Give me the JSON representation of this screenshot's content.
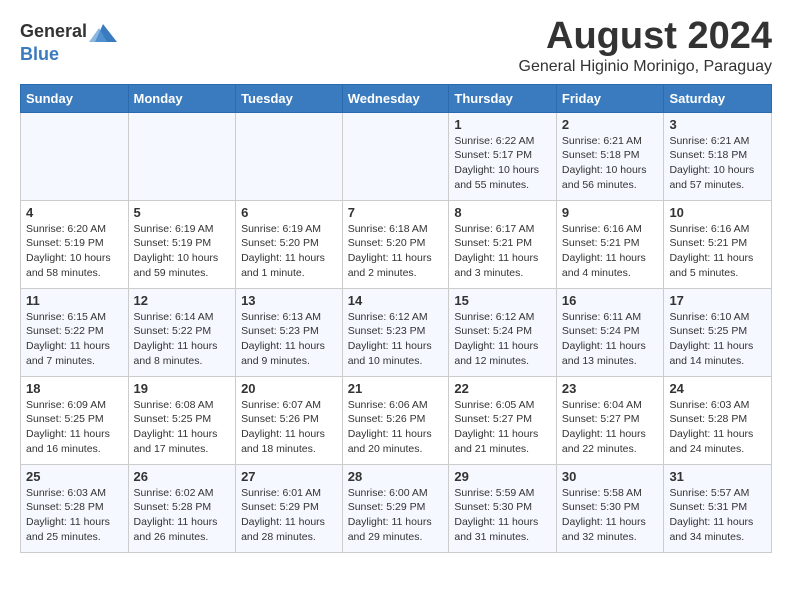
{
  "header": {
    "logo_general": "General",
    "logo_blue": "Blue",
    "title": "August 2024",
    "subtitle": "General Higinio Morinigo, Paraguay"
  },
  "days_of_week": [
    "Sunday",
    "Monday",
    "Tuesday",
    "Wednesday",
    "Thursday",
    "Friday",
    "Saturday"
  ],
  "weeks": [
    [
      {
        "day": "",
        "info": ""
      },
      {
        "day": "",
        "info": ""
      },
      {
        "day": "",
        "info": ""
      },
      {
        "day": "",
        "info": ""
      },
      {
        "day": "1",
        "info": "Sunrise: 6:22 AM\nSunset: 5:17 PM\nDaylight: 10 hours\nand 55 minutes."
      },
      {
        "day": "2",
        "info": "Sunrise: 6:21 AM\nSunset: 5:18 PM\nDaylight: 10 hours\nand 56 minutes."
      },
      {
        "day": "3",
        "info": "Sunrise: 6:21 AM\nSunset: 5:18 PM\nDaylight: 10 hours\nand 57 minutes."
      }
    ],
    [
      {
        "day": "4",
        "info": "Sunrise: 6:20 AM\nSunset: 5:19 PM\nDaylight: 10 hours\nand 58 minutes."
      },
      {
        "day": "5",
        "info": "Sunrise: 6:19 AM\nSunset: 5:19 PM\nDaylight: 10 hours\nand 59 minutes."
      },
      {
        "day": "6",
        "info": "Sunrise: 6:19 AM\nSunset: 5:20 PM\nDaylight: 11 hours\nand 1 minute."
      },
      {
        "day": "7",
        "info": "Sunrise: 6:18 AM\nSunset: 5:20 PM\nDaylight: 11 hours\nand 2 minutes."
      },
      {
        "day": "8",
        "info": "Sunrise: 6:17 AM\nSunset: 5:21 PM\nDaylight: 11 hours\nand 3 minutes."
      },
      {
        "day": "9",
        "info": "Sunrise: 6:16 AM\nSunset: 5:21 PM\nDaylight: 11 hours\nand 4 minutes."
      },
      {
        "day": "10",
        "info": "Sunrise: 6:16 AM\nSunset: 5:21 PM\nDaylight: 11 hours\nand 5 minutes."
      }
    ],
    [
      {
        "day": "11",
        "info": "Sunrise: 6:15 AM\nSunset: 5:22 PM\nDaylight: 11 hours\nand 7 minutes."
      },
      {
        "day": "12",
        "info": "Sunrise: 6:14 AM\nSunset: 5:22 PM\nDaylight: 11 hours\nand 8 minutes."
      },
      {
        "day": "13",
        "info": "Sunrise: 6:13 AM\nSunset: 5:23 PM\nDaylight: 11 hours\nand 9 minutes."
      },
      {
        "day": "14",
        "info": "Sunrise: 6:12 AM\nSunset: 5:23 PM\nDaylight: 11 hours\nand 10 minutes."
      },
      {
        "day": "15",
        "info": "Sunrise: 6:12 AM\nSunset: 5:24 PM\nDaylight: 11 hours\nand 12 minutes."
      },
      {
        "day": "16",
        "info": "Sunrise: 6:11 AM\nSunset: 5:24 PM\nDaylight: 11 hours\nand 13 minutes."
      },
      {
        "day": "17",
        "info": "Sunrise: 6:10 AM\nSunset: 5:25 PM\nDaylight: 11 hours\nand 14 minutes."
      }
    ],
    [
      {
        "day": "18",
        "info": "Sunrise: 6:09 AM\nSunset: 5:25 PM\nDaylight: 11 hours\nand 16 minutes."
      },
      {
        "day": "19",
        "info": "Sunrise: 6:08 AM\nSunset: 5:25 PM\nDaylight: 11 hours\nand 17 minutes."
      },
      {
        "day": "20",
        "info": "Sunrise: 6:07 AM\nSunset: 5:26 PM\nDaylight: 11 hours\nand 18 minutes."
      },
      {
        "day": "21",
        "info": "Sunrise: 6:06 AM\nSunset: 5:26 PM\nDaylight: 11 hours\nand 20 minutes."
      },
      {
        "day": "22",
        "info": "Sunrise: 6:05 AM\nSunset: 5:27 PM\nDaylight: 11 hours\nand 21 minutes."
      },
      {
        "day": "23",
        "info": "Sunrise: 6:04 AM\nSunset: 5:27 PM\nDaylight: 11 hours\nand 22 minutes."
      },
      {
        "day": "24",
        "info": "Sunrise: 6:03 AM\nSunset: 5:28 PM\nDaylight: 11 hours\nand 24 minutes."
      }
    ],
    [
      {
        "day": "25",
        "info": "Sunrise: 6:03 AM\nSunset: 5:28 PM\nDaylight: 11 hours\nand 25 minutes."
      },
      {
        "day": "26",
        "info": "Sunrise: 6:02 AM\nSunset: 5:28 PM\nDaylight: 11 hours\nand 26 minutes."
      },
      {
        "day": "27",
        "info": "Sunrise: 6:01 AM\nSunset: 5:29 PM\nDaylight: 11 hours\nand 28 minutes."
      },
      {
        "day": "28",
        "info": "Sunrise: 6:00 AM\nSunset: 5:29 PM\nDaylight: 11 hours\nand 29 minutes."
      },
      {
        "day": "29",
        "info": "Sunrise: 5:59 AM\nSunset: 5:30 PM\nDaylight: 11 hours\nand 31 minutes."
      },
      {
        "day": "30",
        "info": "Sunrise: 5:58 AM\nSunset: 5:30 PM\nDaylight: 11 hours\nand 32 minutes."
      },
      {
        "day": "31",
        "info": "Sunrise: 5:57 AM\nSunset: 5:31 PM\nDaylight: 11 hours\nand 34 minutes."
      }
    ]
  ]
}
